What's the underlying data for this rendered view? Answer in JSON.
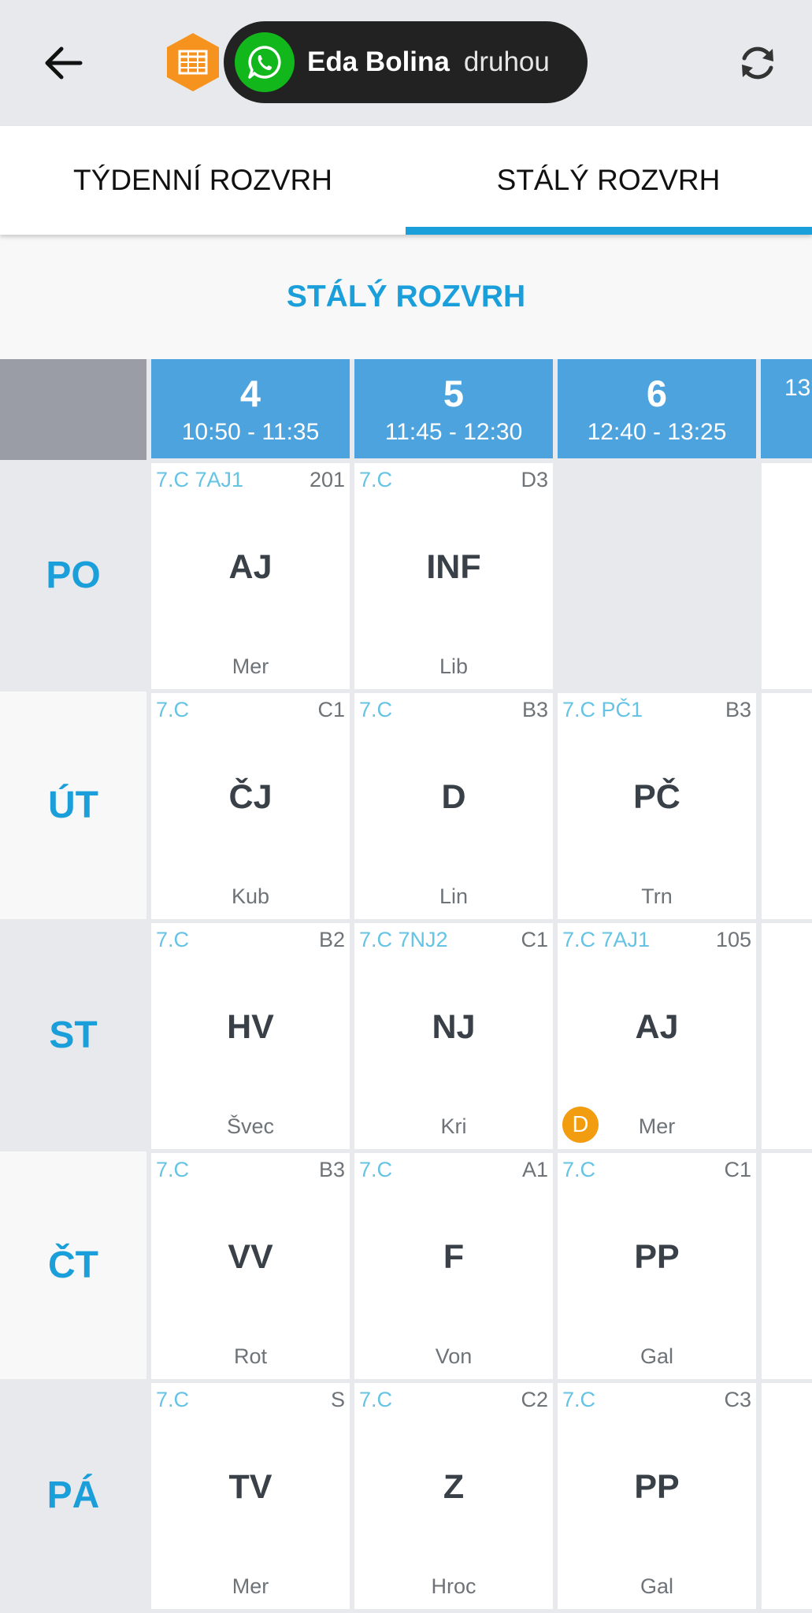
{
  "appbar": {
    "contact_name": "Eda Bolina",
    "contact_status": "druhou",
    "app_icon": "calendar-table-icon",
    "app_icon_color": "#f5931e",
    "whatsapp_color": "#12b81b"
  },
  "tabs": [
    {
      "label": "TÝDENNÍ ROZVRH",
      "active": false
    },
    {
      "label": "STÁLÝ ROZVRH",
      "active": true
    }
  ],
  "section_title": "STÁLÝ ROZVRH",
  "colors": {
    "accent": "#1a9fdb",
    "header_bg": "#4ca3de",
    "badge": "#f29c10"
  },
  "periods": [
    {
      "num": "4",
      "time": "10:50 - 11:35"
    },
    {
      "num": "5",
      "time": "11:45 - 12:30"
    },
    {
      "num": "6",
      "time": "12:40 - 13:25"
    },
    {
      "num": "",
      "time": "13"
    }
  ],
  "days": [
    {
      "label": "PO",
      "lessons": [
        {
          "cls": "7.C 7AJ1",
          "room": "201",
          "subject": "AJ",
          "teacher": "Mer"
        },
        {
          "cls": "7.C",
          "room": "D3",
          "subject": "INF",
          "teacher": "Lib"
        },
        null
      ]
    },
    {
      "label": "ÚT",
      "lessons": [
        {
          "cls": "7.C",
          "room": "C1",
          "subject": "ČJ",
          "teacher": "Kub"
        },
        {
          "cls": "7.C",
          "room": "B3",
          "subject": "D",
          "teacher": "Lin"
        },
        {
          "cls": "7.C PČ1",
          "room": "B3",
          "subject": "PČ",
          "teacher": "Trn"
        }
      ]
    },
    {
      "label": "ST",
      "lessons": [
        {
          "cls": "7.C",
          "room": "B2",
          "subject": "HV",
          "teacher": "Švec"
        },
        {
          "cls": "7.C 7NJ2",
          "room": "C1",
          "subject": "NJ",
          "teacher": "Kri"
        },
        {
          "cls": "7.C 7AJ1",
          "room": "105",
          "subject": "AJ",
          "teacher": "Mer",
          "badge": "D"
        }
      ]
    },
    {
      "label": "ČT",
      "lessons": [
        {
          "cls": "7.C",
          "room": "B3",
          "subject": "VV",
          "teacher": "Rot"
        },
        {
          "cls": "7.C",
          "room": "A1",
          "subject": "F",
          "teacher": "Von"
        },
        {
          "cls": "7.C",
          "room": "C1",
          "subject": "PP",
          "teacher": "Gal"
        }
      ]
    },
    {
      "label": "PÁ",
      "lessons": [
        {
          "cls": "7.C",
          "room": "S",
          "subject": "TV",
          "teacher": "Mer"
        },
        {
          "cls": "7.C",
          "room": "C2",
          "subject": "Z",
          "teacher": "Hroc"
        },
        {
          "cls": "7.C",
          "room": "C3",
          "subject": "PP",
          "teacher": "Gal"
        }
      ]
    }
  ]
}
